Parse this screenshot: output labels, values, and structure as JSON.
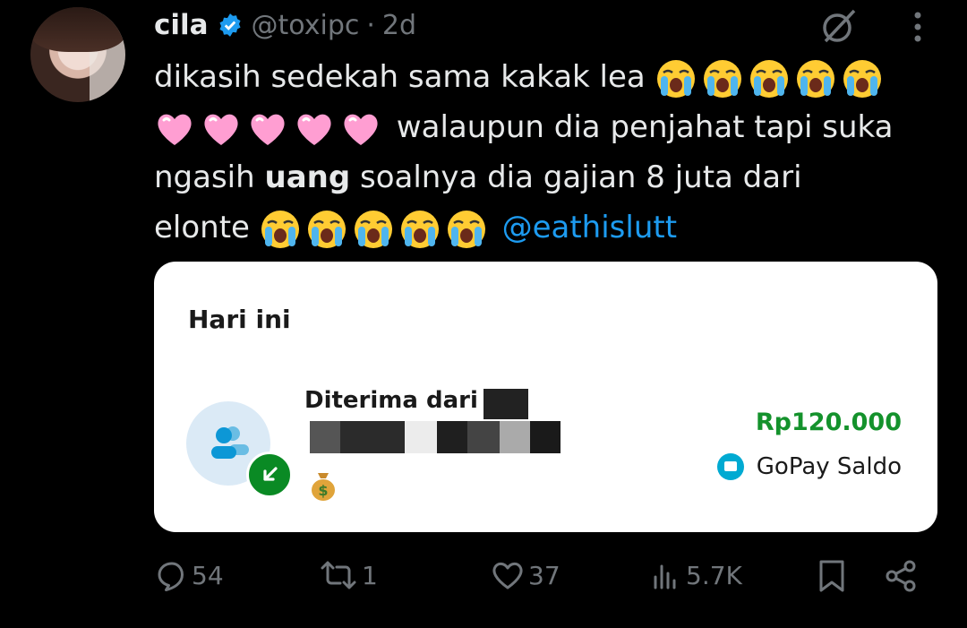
{
  "tweet": {
    "author_name": "cila",
    "handle": "@toxipc",
    "separator": "·",
    "time": "2d",
    "text": {
      "line1_prefix": "dikasih sedekah sama kakak lea ",
      "line2_suffix": " walaupun dia penjahat tapi suka",
      "line3_prefix": "ngasih ",
      "line3_bold": "uang",
      "line3_suffix": " soalnya dia gajian 8 juta dari",
      "line4_prefix": "elonte ",
      "mention": "@eathislutt"
    },
    "emojis": {
      "crying": "loudly-crying-face",
      "heart": "pink-heart"
    }
  },
  "card": {
    "section_title": "Hari ini",
    "received_label": "Diterima dari",
    "amount": "Rp120.000",
    "wallet": "GoPay Saldo",
    "emoji": "money-bag"
  },
  "actions": {
    "replies": "54",
    "reposts": "1",
    "likes": "37",
    "views": "5.7K"
  },
  "colors": {
    "background": "#000000",
    "text": "#e7e9ea",
    "muted": "#71767b",
    "link": "#1d9bf0",
    "amount_green": "#14922c",
    "badge_green": "#0a8a24"
  }
}
